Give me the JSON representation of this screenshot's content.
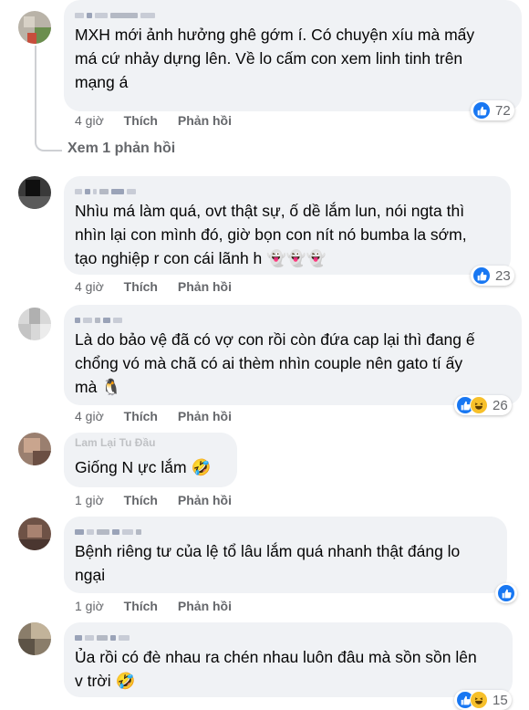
{
  "labels": {
    "like": "Thích",
    "reply": "Phản hồi"
  },
  "colors": {
    "like_blue": "#1877f2",
    "bubble": "#f0f2f5",
    "meta": "#65676b"
  },
  "view_replies": "Xem 1 phản hồi",
  "comments": [
    {
      "lines": [
        "MXH mới ảnh hưởng ghê gớm í. Có chuyện xíu mà mấy",
        "má cứ nhảy dựng lên. Về lo cấm con xem linh tinh trên",
        "mạng á"
      ],
      "time": "4 giờ",
      "reactions": [
        "like"
      ],
      "count": "72"
    },
    {
      "lines": [
        "Nhìu má làm quá, ovt thật sự, ố dề lắm lun, nói ngta thì",
        "nhìn lại con mình đó, giờ bọn con nít nó bumba la sớm,",
        "tạo nghiệp r con cái lãnh h 👻👻👻"
      ],
      "time": "4 giờ",
      "reactions": [
        "like"
      ],
      "count": "23"
    },
    {
      "lines": [
        "Là do bảo vệ đã có vợ con rồi còn đứa cap lại thì đang ế",
        "chổng vó mà chã có ai thèm nhìn couple nên gato tí ấy",
        "mà 🐧"
      ],
      "time": "4 giờ",
      "reactions": [
        "like",
        "haha"
      ],
      "count": "26"
    },
    {
      "author_hint": "Lam Lại Tu Đầu",
      "lines": [
        "Giống N    ực lắm 🤣"
      ],
      "time": "1 giờ",
      "reactions": [],
      "count": ""
    },
    {
      "lines": [
        "Bệnh riêng tư của lệ tổ lâu lắm quá nhanh thật đáng lo",
        "ngại"
      ],
      "time": "1 giờ",
      "reactions": [
        "like"
      ],
      "count": ""
    },
    {
      "lines": [
        "Ủa rồi có đè nhau ra chén nhau luôn đâu mà sồn sồn lên",
        "v trời 🤣"
      ],
      "time": "",
      "reactions": [
        "like",
        "haha"
      ],
      "count": "15"
    }
  ]
}
